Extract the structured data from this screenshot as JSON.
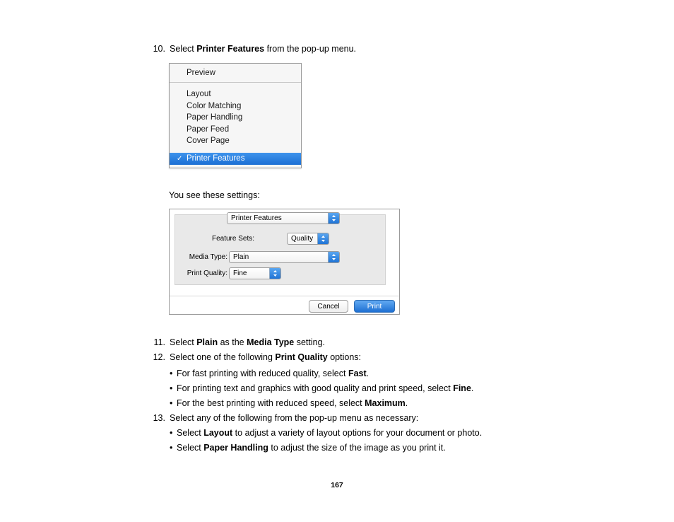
{
  "document": {
    "page_number": "167",
    "steps": [
      {
        "num": "10.",
        "text_before": "Select ",
        "bold": "Printer Features",
        "text_after": " from the pop-up menu."
      },
      {
        "num": "11.",
        "text_before": "Select ",
        "bold": "Plain",
        "mid": " as the ",
        "bold2": "Media Type",
        "text_after": " setting."
      },
      {
        "num": "12.",
        "text_before": "Select one of the following ",
        "bold": "Print Quality",
        "text_after": " options:"
      },
      {
        "num": "13.",
        "text_before": "Select any of the following from the pop-up menu as necessary:",
        "bold": "",
        "text_after": ""
      }
    ],
    "paragraph_settings": "You see these settings:",
    "bullets_quality": [
      {
        "dot": "•",
        "text_before": "For fast printing with reduced quality, select ",
        "bold": "Fast",
        "text_after": "."
      },
      {
        "dot": "•",
        "text_before": "For printing text and graphics with good quality and print speed, select ",
        "bold": "Fine",
        "text_after": "."
      },
      {
        "dot": "•",
        "text_before": "For the best printing with reduced speed, select ",
        "bold": "Maximum",
        "text_after": "."
      }
    ],
    "bullets_popup": [
      {
        "dot": "•",
        "text_before": "Select ",
        "bold": "Layout",
        "text_after": " to adjust a variety of layout options for your document or photo."
      },
      {
        "dot": "•",
        "text_before": "Select ",
        "bold": "Paper Handling",
        "text_after": " to adjust the size of the image as you print it."
      }
    ]
  },
  "popup_menu": {
    "header_item": "Preview",
    "items": [
      "Layout",
      "Color Matching",
      "Paper Handling",
      "Paper Feed",
      "Cover Page"
    ],
    "selected_item": "Printer Features",
    "check_glyph": "✓"
  },
  "print_dialog": {
    "pane_popup_value": "Printer Features",
    "feature_sets_label": "Feature Sets:",
    "feature_sets_value": "Quality",
    "media_type_label": "Media Type:",
    "media_type_value": "Plain",
    "print_quality_label": "Print Quality:",
    "print_quality_value": "Fine",
    "cancel_label": "Cancel",
    "print_label": "Print"
  },
  "colors": {
    "selection_blue": "#2a7fe0",
    "primary_button_blue": "#1d6fd2",
    "panel_gray": "#e9e9e9"
  }
}
